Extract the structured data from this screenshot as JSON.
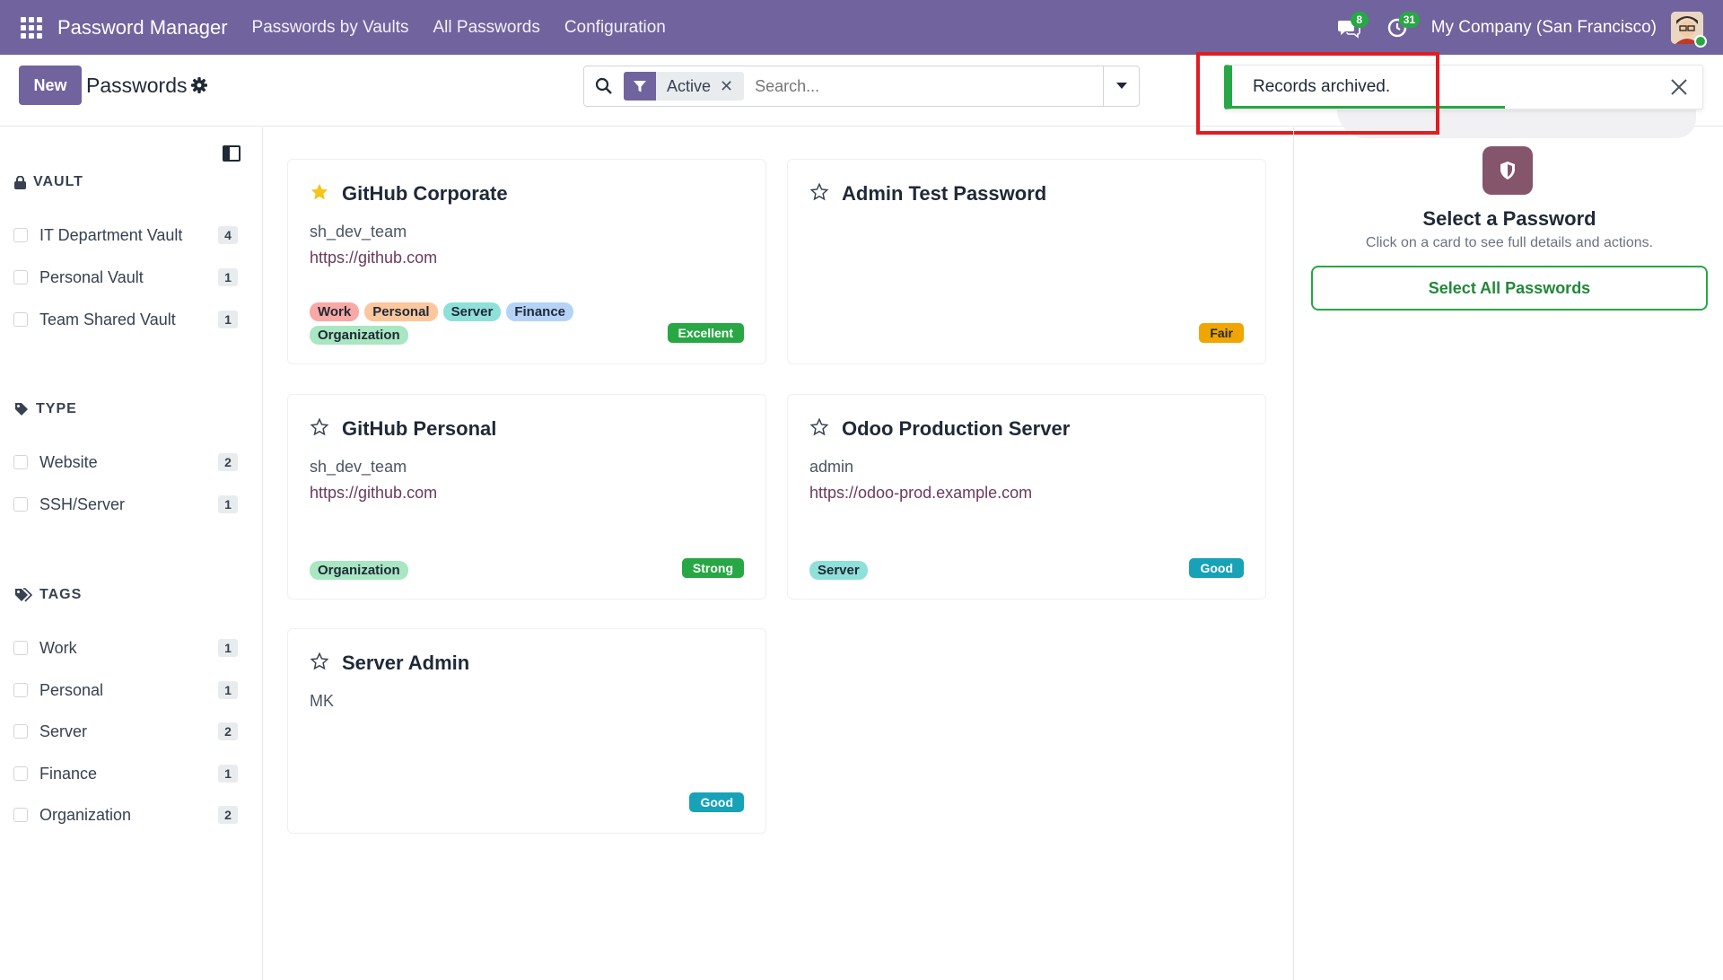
{
  "navbar": {
    "brand": "Password Manager",
    "menu": [
      "Passwords by Vaults",
      "All Passwords",
      "Configuration"
    ],
    "messages_count": "8",
    "activities_count": "31",
    "company": "My Company (San Francisco)"
  },
  "control": {
    "new_label": "New",
    "title": "Passwords",
    "facet_label": "Active",
    "facet_remove": "✕",
    "search_placeholder": "Search..."
  },
  "notification": {
    "text": "Records archived.",
    "progress": 0.58
  },
  "sidebar": {
    "vault": {
      "heading": "VAULT",
      "items": [
        {
          "label": "IT Department Vault",
          "count": "4"
        },
        {
          "label": "Personal Vault",
          "count": "1"
        },
        {
          "label": "Team Shared Vault",
          "count": "1"
        }
      ]
    },
    "type": {
      "heading": "TYPE",
      "items": [
        {
          "label": "Website",
          "count": "2"
        },
        {
          "label": "SSH/Server",
          "count": "1"
        }
      ]
    },
    "tags": {
      "heading": "TAGS",
      "items": [
        {
          "label": "Work",
          "count": "1"
        },
        {
          "label": "Personal",
          "count": "1"
        },
        {
          "label": "Server",
          "count": "2"
        },
        {
          "label": "Finance",
          "count": "1"
        },
        {
          "label": "Organization",
          "count": "2"
        }
      ]
    }
  },
  "cards": [
    {
      "title": "GitHub Corporate",
      "favorite": true,
      "user": "sh_dev_team",
      "url": "https://github.com",
      "tags": [
        "Work",
        "Personal",
        "Server",
        "Finance",
        "Organization"
      ],
      "strength": "Excellent"
    },
    {
      "title": "Admin Test Password",
      "favorite": false,
      "user": "",
      "url": "",
      "tags": [],
      "strength": "Fair"
    },
    {
      "title": "GitHub Personal",
      "favorite": false,
      "user": "sh_dev_team",
      "url": "https://github.com",
      "tags": [
        "Organization"
      ],
      "strength": "Strong"
    },
    {
      "title": "Odoo Production Server",
      "favorite": false,
      "user": "admin",
      "url": "https://odoo-prod.example.com",
      "tags": [
        "Server"
      ],
      "strength": "Good"
    },
    {
      "title": "Server Admin",
      "favorite": false,
      "user": "MK",
      "url": "",
      "tags": [],
      "strength": "Good"
    }
  ],
  "right_panel": {
    "title": "Select a Password",
    "subtitle": "Click on a card to see full details and actions.",
    "button_label": "Select All Passwords"
  },
  "colors": {
    "navbar": "#71639e",
    "success": "#28a745",
    "info": "#17a2b8",
    "warning": "#f0a500",
    "highlight": "#e11d22"
  }
}
